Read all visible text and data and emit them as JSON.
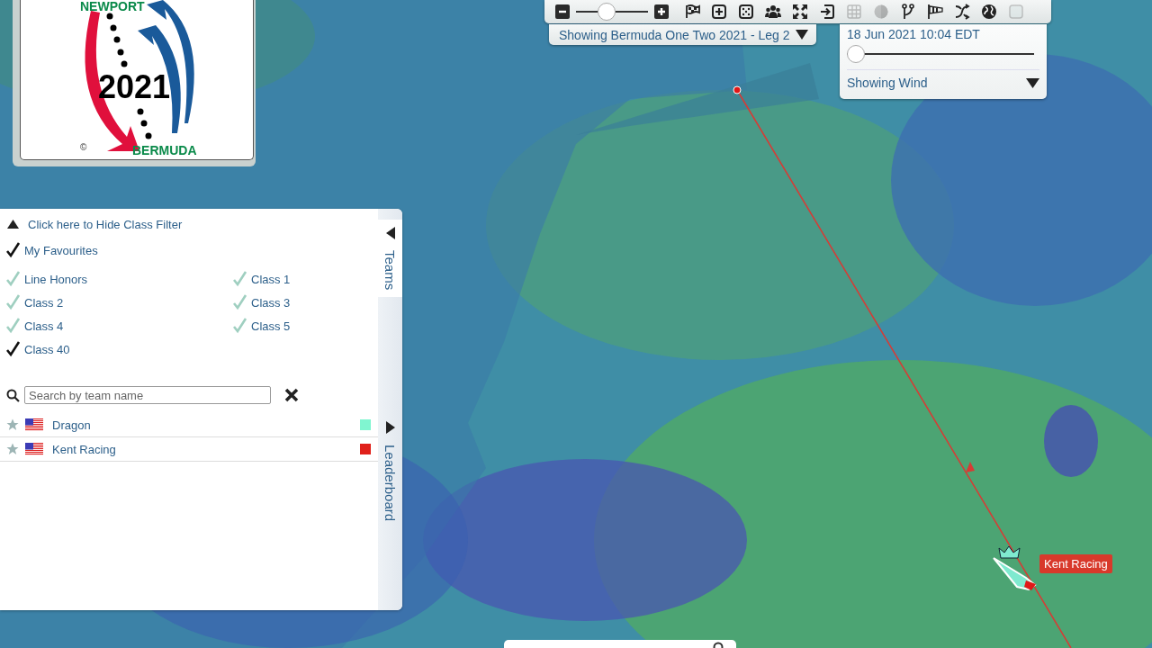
{
  "logo": {
    "top_text": "NEWPORT",
    "year": "2021",
    "bottom_text": "BERMUDA",
    "copyright": "©"
  },
  "toolbar": {
    "zoom": {
      "level": 0.4
    },
    "tools": [
      {
        "kind": "flag",
        "disabled": false
      },
      {
        "kind": "add",
        "disabled": false
      },
      {
        "kind": "dice",
        "disabled": false
      },
      {
        "kind": "group",
        "disabled": false
      },
      {
        "kind": "expand",
        "disabled": false
      },
      {
        "kind": "enter",
        "disabled": false
      },
      {
        "kind": "grid",
        "disabled": true
      },
      {
        "kind": "contrast",
        "disabled": true
      },
      {
        "kind": "fork",
        "disabled": false
      },
      {
        "kind": "windsock",
        "disabled": false
      },
      {
        "kind": "route",
        "disabled": false
      },
      {
        "kind": "globe",
        "disabled": false
      },
      {
        "kind": "square",
        "disabled": true
      }
    ]
  },
  "race_selector": {
    "label": "Showing Bermuda One Two 2021 - Leg 2"
  },
  "time_panel": {
    "time": "18 Jun 2021 10:04 EDT",
    "level": 0,
    "layer": "Showing Wind"
  },
  "side_panel": {
    "tabs": [
      {
        "label": "Teams",
        "selected": true
      },
      {
        "label": "Leaderboard",
        "selected": false
      }
    ],
    "filter_toggle": "Click here to Hide Class Filter",
    "favourites": {
      "label": "My Favourites",
      "checked": true
    },
    "classes": [
      {
        "label": "Line Honors",
        "checked": false
      },
      {
        "label": "Class 1",
        "checked": false
      },
      {
        "label": "Class 2",
        "checked": false
      },
      {
        "label": "Class 3",
        "checked": false
      },
      {
        "label": "Class 4",
        "checked": false
      },
      {
        "label": "Class 5",
        "checked": false
      },
      {
        "label": "Class 40",
        "checked": true
      }
    ],
    "search": {
      "placeholder": "Search by team name"
    },
    "teams": [
      {
        "name": "Dragon",
        "favourite": false,
        "color": "#80f5d0"
      },
      {
        "name": "Kent Racing",
        "favourite": false,
        "color": "#e0201a"
      }
    ]
  },
  "map_overlay": {
    "boat_label": "Kent Racing"
  }
}
